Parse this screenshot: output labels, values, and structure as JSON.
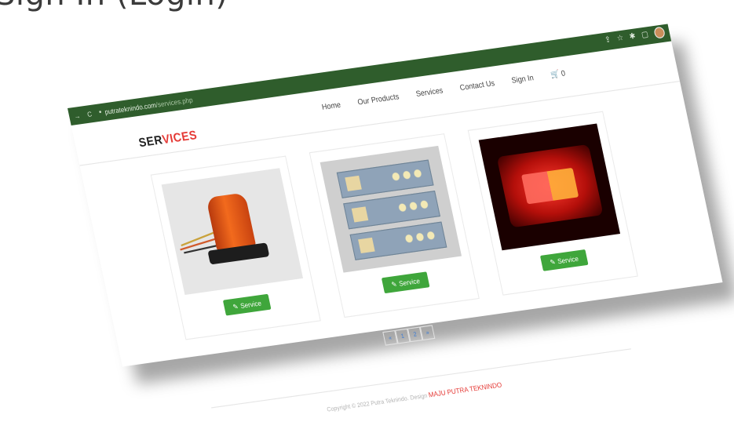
{
  "slide_title": "Sign In (Login)",
  "browser": {
    "url_host": "putrateknindo.com",
    "url_path": "/services.php",
    "nav_back_icon": "→",
    "reload_icon": "C",
    "lock_icon": "●",
    "right_icons": [
      "⇪",
      "☆",
      "✱",
      "▢"
    ]
  },
  "site": {
    "brand_prefix": "SER",
    "brand_accent": "VICES",
    "nav": [
      "Home",
      "Our Products",
      "Services",
      "Contact Us",
      "Sign In"
    ],
    "cart_icon": "🛒",
    "cart_count": "0"
  },
  "products": [
    {
      "image": "rotating-beacon-light",
      "button_label": "Service"
    },
    {
      "image": "led-pcb-modules",
      "button_label": "Service"
    },
    {
      "image": "red-led-tail-lamp",
      "button_label": "Service"
    }
  ],
  "pagination": [
    "«",
    "1",
    "2",
    "»"
  ],
  "footer": {
    "text": "Copyright © 2022 Putra Teknindo. Design",
    "brand": "MAJU PUTRA TEKNINDO"
  },
  "colors": {
    "chrome_green": "#2f5d2c",
    "accent_red": "#e53935",
    "button_green": "#3fa63b"
  }
}
